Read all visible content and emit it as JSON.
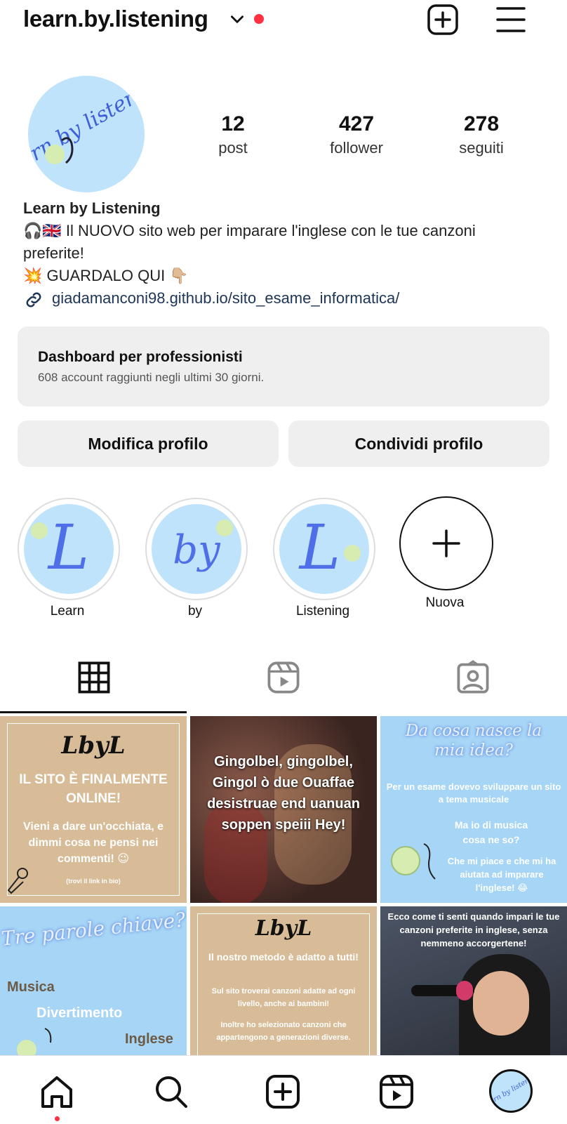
{
  "header": {
    "username": "learn.by.listening",
    "icons": [
      "chevron-down-icon",
      "new-post-icon",
      "menu-icon"
    ],
    "notification_color": "#ff3040"
  },
  "profile": {
    "avatar_text": "Learn by listening",
    "stats": [
      {
        "value": "12",
        "label": "post"
      },
      {
        "value": "427",
        "label": "follower"
      },
      {
        "value": "278",
        "label": "seguiti"
      }
    ],
    "name": "Learn by Listening",
    "bio_lines": [
      "🎧🇬🇧 Il NUOVO sito web per imparare l'inglese con le tue canzoni",
      "preferite!",
      "💥 GUARDALO QUI 👇🏼"
    ],
    "link": "giadamanconi98.github.io/sito_esame_informatica/"
  },
  "dashboard": {
    "title": "Dashboard per professionisti",
    "subtitle": "608 account raggiunti negli ultimi 30 giorni."
  },
  "buttons": {
    "edit": "Modifica profilo",
    "share": "Condividi profilo"
  },
  "highlights": [
    {
      "label": "Learn",
      "glyph": "L"
    },
    {
      "label": "by",
      "glyph": "by"
    },
    {
      "label": "Listening",
      "glyph": "L"
    },
    {
      "label": "Nuova"
    }
  ],
  "tabs": [
    "grid-icon",
    "reels-icon",
    "tagged-icon"
  ],
  "posts": [
    {
      "logo": "LbyL",
      "title": "IL SITO È FINALMENTE ONLINE!",
      "body": "Vieni a dare un'occhiata, e dimmi cosa ne pensi nei commenti! 😉",
      "note": "(trovi il link in bio)",
      "bg": "#d8bc97"
    },
    {
      "text": "Gingolbel, gingolbel, Gingol ò due Ouaffae desistruae end uanuan soppen speiii Hey!",
      "bg": "#5a3a36"
    },
    {
      "title": "Da cosa nasce la mia idea?",
      "body1": "Per un esame dovevo sviluppare un sito a tema musicale",
      "body2": "Ma io di musica cosa ne so?",
      "body3": "Che mi piace e che mi ha aiutata ad imparare l'inglese! 😂",
      "bg": "#a6d5f5"
    },
    {
      "title": "Tre parole chiave?",
      "w1": "Musica",
      "w2": "Divertimento",
      "w3": "Inglese",
      "bg": "#a6d5f5"
    },
    {
      "logo": "LbyL",
      "title": "Il nostro metodo è adatto a tutti!",
      "body1": "Sul sito troverai canzoni adatte ad ogni livello, anche ai bambini!",
      "body2": "Inoltre ho selezionato canzoni che appartengono a generazioni diverse.",
      "bg": "#d8bc97"
    },
    {
      "text": "Ecco come ti senti quando impari le tue canzoni preferite in inglese, senza nemmeno accorgertene!",
      "bg": "#3a3f4b"
    }
  ],
  "bottom_nav": [
    "home-icon",
    "search-icon",
    "create-icon",
    "reels-icon",
    "profile-avatar"
  ]
}
